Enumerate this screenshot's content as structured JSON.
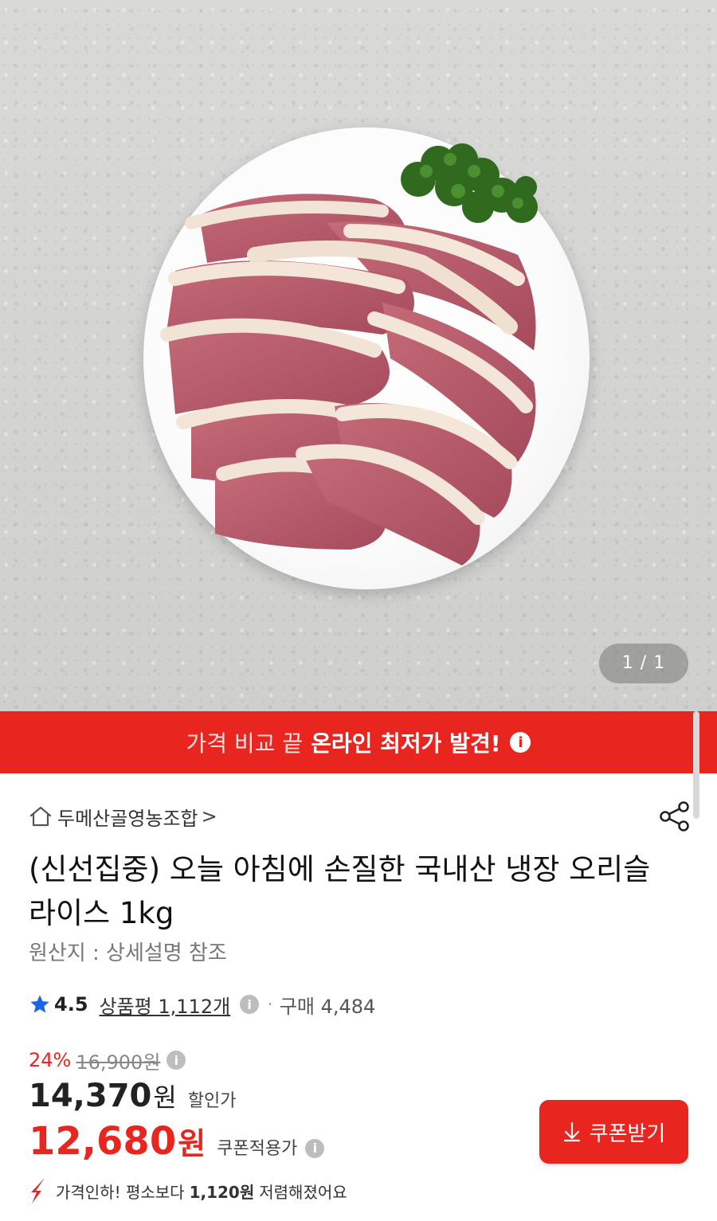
{
  "gallery": {
    "page_indicator": "1 / 1",
    "image_alt_icon": "duck-slices-plate-image"
  },
  "banner": {
    "prefix": "가격 비교 끝",
    "highlight": "온라인 최저가 발견!",
    "info_icon": "info-icon",
    "background_color": "#e8261f"
  },
  "store": {
    "icon": "home-icon",
    "name": "두메산골영농조합",
    "chevron": ">"
  },
  "share_icon": "share-icon",
  "product": {
    "title": "(신선집중) 오늘 아침에 손질한 국내산 냉장 오리슬라이스 1kg",
    "origin": "원산지 : 상세설명 참조"
  },
  "rating": {
    "star_icon": "star-icon",
    "score": "4.5",
    "reviews": "상품평 1,112개",
    "separator": "·",
    "sales": "구매 4,484",
    "star_color": "#1a66e6"
  },
  "price": {
    "discount_percent": "24%",
    "original": "16,900원",
    "sale_amount": "14,370",
    "sale_unit": "원",
    "sale_label": "할인가",
    "coupon_amount": "12,680",
    "coupon_unit": "원",
    "coupon_label": "쿠폰적용가",
    "accent_color": "#e8261f"
  },
  "coupon_button": {
    "label": "쿠폰받기",
    "icon": "download-arrow-icon"
  },
  "price_drop": {
    "icon": "down-arrow-icon",
    "text_prefix": "가격인하! 평소보다",
    "amount": "1,120원",
    "text_suffix": "저렴해졌어요"
  }
}
